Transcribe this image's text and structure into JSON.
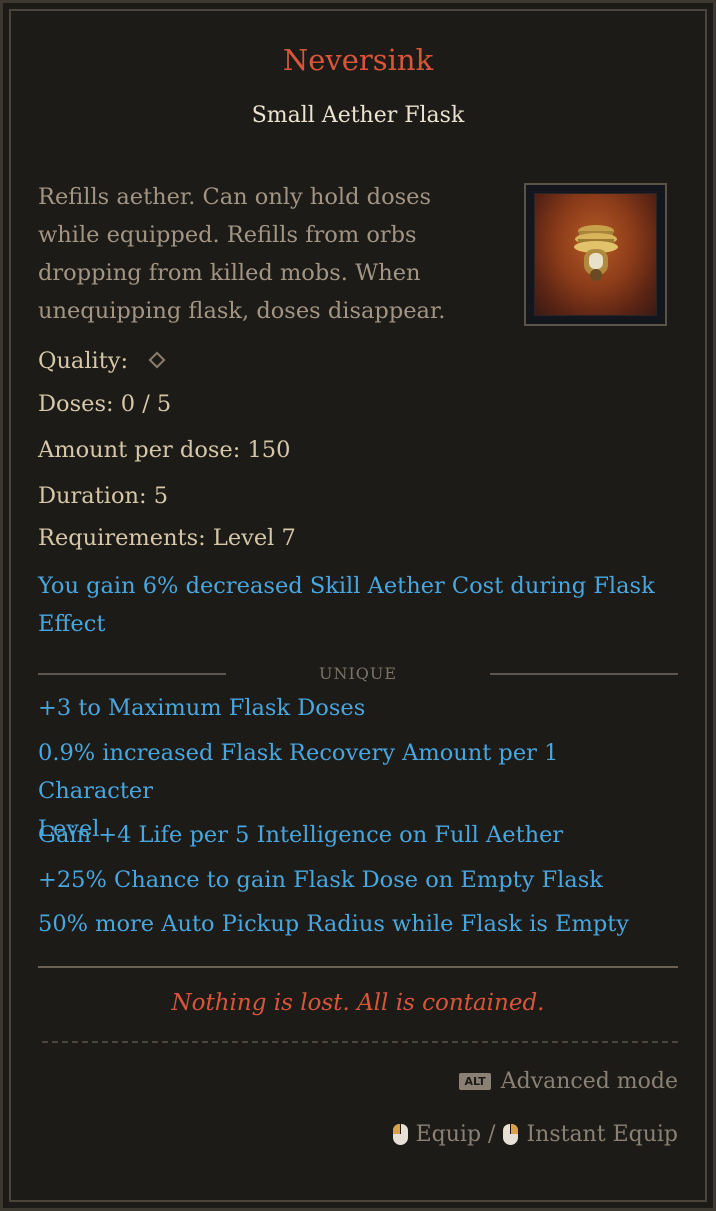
{
  "item": {
    "name": "Neversink",
    "base_type": "Small Aether Flask",
    "description": [
      "Refills aether. Can only hold doses",
      "while equipped. Refills from orbs",
      "dropping from killed mobs. When",
      "unequipping flask, doses disappear."
    ],
    "icon": "aether-flask-icon",
    "colors": {
      "unique_name": "#d9553a",
      "modifier": "#49a7e0",
      "flavor": "#d9553a"
    }
  },
  "stats": {
    "quality_label": "Quality:",
    "doses_label": "Doses:",
    "doses_value": "0 / 5",
    "amount_label": "Amount per dose:",
    "amount_value": "150",
    "duration_label": "Duration:",
    "duration_value": "5",
    "requirements_label": "Requirements:",
    "requirements_value": "Level 7"
  },
  "implicit": [
    "You gain 6% decreased Skill Aether Cost during Flask",
    "Effect"
  ],
  "unique_label": "UNIQUE",
  "modifiers": {
    "m1": "+3 to Maximum Flask Doses",
    "m2a": "0.9% increased Flask Recovery Amount per 1 Character",
    "m2b": "Level",
    "m3": "Gain +4 Life per 5 Intelligence on Full Aether",
    "m4": "+25% Chance to gain Flask Dose on Empty Flask",
    "m5": "50% more Auto Pickup Radius while Flask is Empty"
  },
  "flavor_text": "Nothing is lost. All is contained.",
  "controls": {
    "alt_key": "ALT",
    "advanced_mode": "Advanced mode",
    "equip": "Equip /",
    "instant_equip": "Instant Equip"
  }
}
